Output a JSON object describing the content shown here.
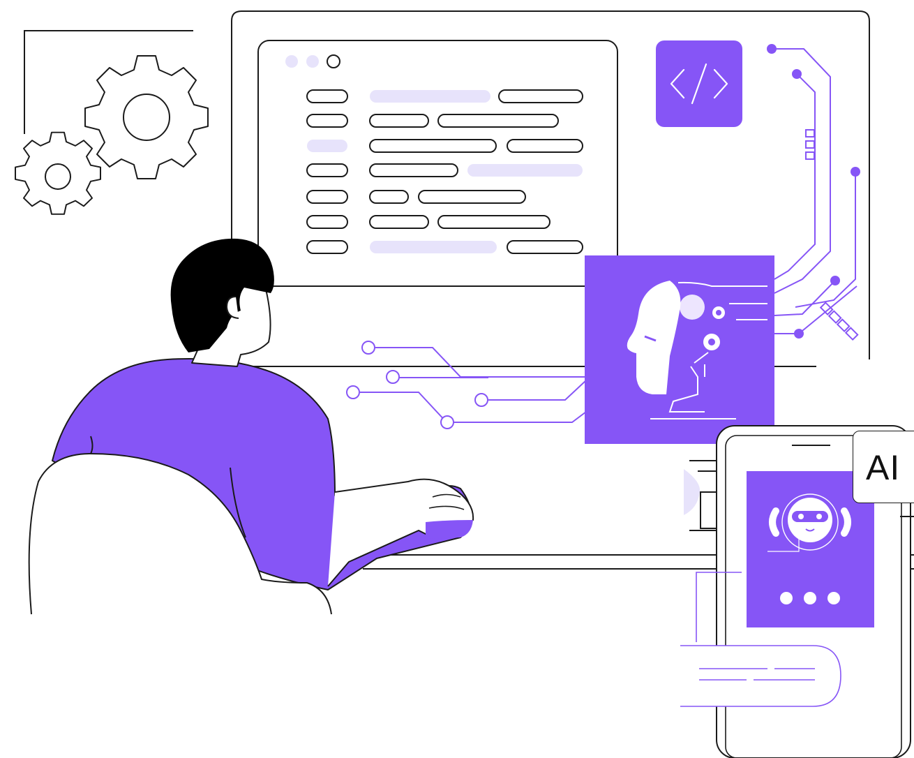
{
  "illustration": {
    "ai_badge_text": "AI",
    "colors": {
      "accent": "#8655f6",
      "accent_light": "#e7e3fb",
      "outline": "#1a1a1a",
      "background": "#ffffff"
    },
    "icons": [
      "gear-icon",
      "code-icon",
      "ai-head-icon",
      "robot-icon",
      "typing-dots-icon"
    ]
  }
}
